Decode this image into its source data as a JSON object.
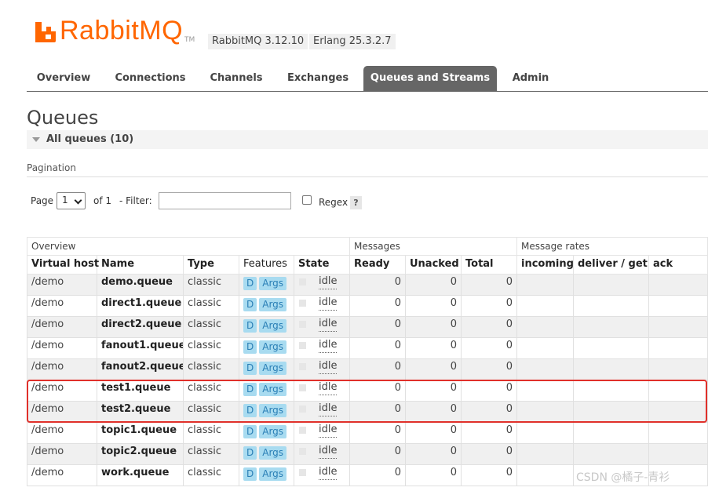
{
  "app": {
    "logo_text": "RabbitMQ",
    "tm": "TM",
    "rabbitmq_version": "RabbitMQ 3.12.10",
    "erlang_version": "Erlang 25.3.2.7"
  },
  "nav": {
    "tabs": [
      {
        "label": "Overview"
      },
      {
        "label": "Connections"
      },
      {
        "label": "Channels"
      },
      {
        "label": "Exchanges"
      },
      {
        "label": "Queues and Streams",
        "active": true
      },
      {
        "label": "Admin"
      }
    ]
  },
  "page": {
    "title": "Queues",
    "section": "All queues (10)",
    "pagination_label": "Pagination"
  },
  "pagination": {
    "page_label": "Page",
    "page_value": "1",
    "of_label": "of 1",
    "filter_label": "- Filter:",
    "filter_value": "",
    "regex_label": "Regex",
    "help": "?"
  },
  "table": {
    "groups": [
      "Overview",
      "Messages",
      "Message rates"
    ],
    "columns": [
      "Virtual host",
      "Name",
      "Type",
      "Features",
      "State",
      "Ready",
      "Unacked",
      "Total",
      "incoming",
      "deliver / get",
      "ack"
    ],
    "rows": [
      {
        "vhost": "/demo",
        "name": "demo.queue",
        "type": "classic",
        "f1": "D",
        "f2": "Args",
        "state": "idle",
        "ready": "0",
        "unacked": "0",
        "total": "0"
      },
      {
        "vhost": "/demo",
        "name": "direct1.queue",
        "type": "classic",
        "f1": "D",
        "f2": "Args",
        "state": "idle",
        "ready": "0",
        "unacked": "0",
        "total": "0"
      },
      {
        "vhost": "/demo",
        "name": "direct2.queue",
        "type": "classic",
        "f1": "D",
        "f2": "Args",
        "state": "idle",
        "ready": "0",
        "unacked": "0",
        "total": "0"
      },
      {
        "vhost": "/demo",
        "name": "fanout1.queue",
        "type": "classic",
        "f1": "D",
        "f2": "Args",
        "state": "idle",
        "ready": "0",
        "unacked": "0",
        "total": "0"
      },
      {
        "vhost": "/demo",
        "name": "fanout2.queue",
        "type": "classic",
        "f1": "D",
        "f2": "Args",
        "state": "idle",
        "ready": "0",
        "unacked": "0",
        "total": "0"
      },
      {
        "vhost": "/demo",
        "name": "test1.queue",
        "type": "classic",
        "f1": "D",
        "f2": "Args",
        "state": "idle",
        "ready": "0",
        "unacked": "0",
        "total": "0"
      },
      {
        "vhost": "/demo",
        "name": "test2.queue",
        "type": "classic",
        "f1": "D",
        "f2": "Args",
        "state": "idle",
        "ready": "0",
        "unacked": "0",
        "total": "0"
      },
      {
        "vhost": "/demo",
        "name": "topic1.queue",
        "type": "classic",
        "f1": "D",
        "f2": "Args",
        "state": "idle",
        "ready": "0",
        "unacked": "0",
        "total": "0"
      },
      {
        "vhost": "/demo",
        "name": "topic2.queue",
        "type": "classic",
        "f1": "D",
        "f2": "Args",
        "state": "idle",
        "ready": "0",
        "unacked": "0",
        "total": "0"
      },
      {
        "vhost": "/demo",
        "name": "work.queue",
        "type": "classic",
        "f1": "D",
        "f2": "Args",
        "state": "idle",
        "ready": "0",
        "unacked": "0",
        "total": "0"
      }
    ]
  },
  "watermark": "CSDN @橘子-青衫",
  "colors": {
    "accent": "#ff6600",
    "active_tab": "#666666",
    "badge_bg": "#a8dbf0",
    "badge_text": "#2a7fb6",
    "highlight": "#e0302a"
  }
}
